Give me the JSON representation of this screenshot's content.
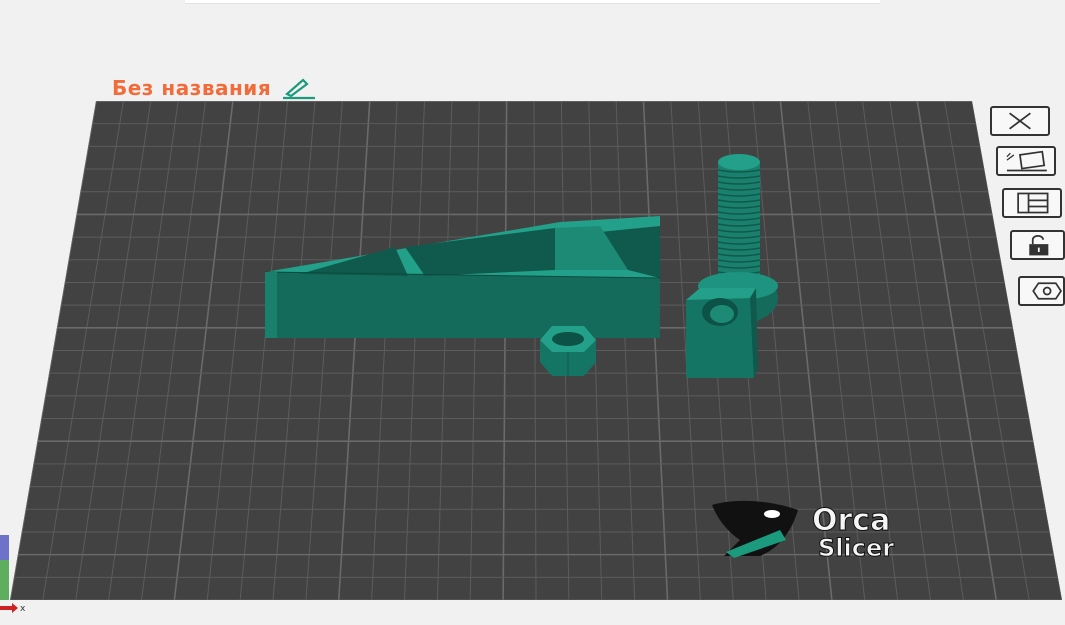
{
  "project": {
    "title": "Без названия"
  },
  "toolbar": {
    "items": [
      {
        "name": "delete",
        "icon": "close-icon"
      },
      {
        "name": "auto-arrange",
        "icon": "auto-arrange-icon"
      },
      {
        "name": "layout",
        "icon": "layout-icon"
      },
      {
        "name": "lock",
        "icon": "unlock-icon"
      },
      {
        "name": "settings",
        "icon": "settings-icon"
      }
    ]
  },
  "logo": {
    "line1": "Orca",
    "line2": "Slicer"
  },
  "axes": {
    "x_label": "x"
  },
  "colors": {
    "accent": "#f26b3a",
    "model": "#1c8a75",
    "bed": "#424242",
    "grid": "#5a5a5a"
  }
}
